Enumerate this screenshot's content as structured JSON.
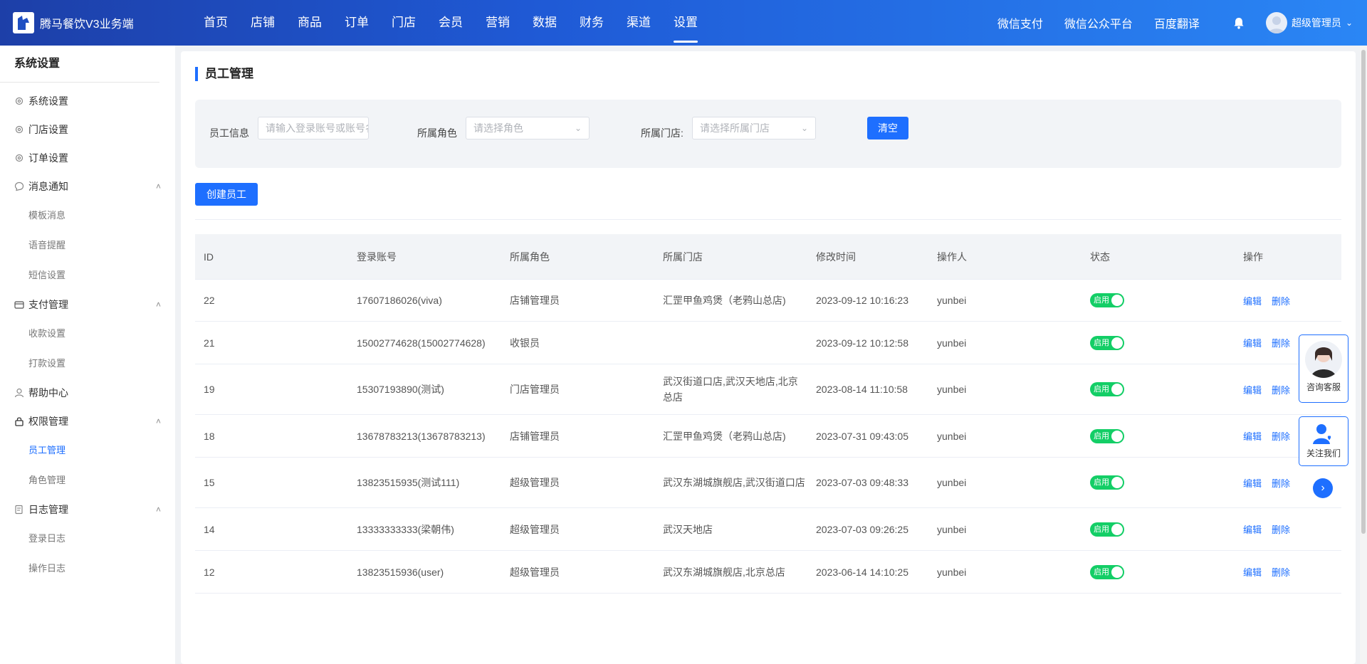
{
  "app": {
    "title": "腾马餐饮V3业务端"
  },
  "topnav": {
    "items": [
      "首页",
      "店铺",
      "商品",
      "订单",
      "门店",
      "会员",
      "营销",
      "数据",
      "财务",
      "渠道",
      "设置"
    ],
    "active_index": 10,
    "right_links": [
      "微信支付",
      "微信公众平台",
      "百度翻译"
    ],
    "user_name": "超级管理员"
  },
  "sidebar": {
    "title": "系统设置",
    "groups": [
      {
        "label": "系统设置",
        "icon": "gear-icon"
      },
      {
        "label": "门店设置",
        "icon": "gear-icon"
      },
      {
        "label": "订单设置",
        "icon": "gear-icon"
      },
      {
        "label": "消息通知",
        "icon": "message-icon",
        "children": [
          "模板消息",
          "语音提醒",
          "短信设置"
        ]
      },
      {
        "label": "支付管理",
        "icon": "payment-icon",
        "children": [
          "收款设置",
          "打款设置"
        ]
      },
      {
        "label": "帮助中心",
        "icon": "user-icon"
      },
      {
        "label": "权限管理",
        "icon": "lock-icon",
        "children": [
          "员工管理",
          "角色管理"
        ],
        "active_child": "员工管理"
      },
      {
        "label": "日志管理",
        "icon": "log-icon",
        "children": [
          "登录日志",
          "操作日志"
        ]
      }
    ]
  },
  "page": {
    "title": "员工管理",
    "filter": {
      "info_label": "员工信息",
      "info_placeholder": "请输入登录账号或账号名称",
      "role_label": "所属角色",
      "role_placeholder": "请选择角色",
      "store_label": "所属门店:",
      "store_placeholder": "请选择所属门店",
      "clear_label": "清空"
    },
    "create_label": "创建员工"
  },
  "table": {
    "headers": [
      "ID",
      "登录账号",
      "所属角色",
      "所属门店",
      "修改时间",
      "操作人",
      "状态",
      "操作"
    ],
    "status_label": "启用",
    "edit_label": "编辑",
    "delete_label": "删除",
    "rows": [
      {
        "id": "22",
        "account": "17607186026(viva)",
        "role": "店铺管理员",
        "store": "汇罡甲鱼鸡煲（老鸦山总店)",
        "time": "2023-09-12 10:16:23",
        "operator": "yunbei"
      },
      {
        "id": "21",
        "account": "15002774628(15002774628)",
        "role": "收银员",
        "store": "",
        "time": "2023-09-12 10:12:58",
        "operator": "yunbei"
      },
      {
        "id": "19",
        "account": "15307193890(测试)",
        "role": "门店管理员",
        "store": "武汉街道口店,武汉天地店,北京总店",
        "time": "2023-08-14 11:10:58",
        "operator": "yunbei"
      },
      {
        "id": "18",
        "account": "13678783213(13678783213)",
        "role": "店铺管理员",
        "store": "汇罡甲鱼鸡煲（老鸦山总店)",
        "time": "2023-07-31 09:43:05",
        "operator": "yunbei"
      },
      {
        "id": "15",
        "account": "13823515935(测试111)",
        "role": "超级管理员",
        "store": "武汉东湖城旗舰店,武汉街道口店",
        "time": "2023-07-03 09:48:33",
        "operator": "yunbei"
      },
      {
        "id": "14",
        "account": "13333333333(梁朝伟)",
        "role": "超级管理员",
        "store": "武汉天地店",
        "time": "2023-07-03 09:26:25",
        "operator": "yunbei"
      },
      {
        "id": "12",
        "account": "13823515936(user)",
        "role": "超级管理员",
        "store": "武汉东湖城旗舰店,北京总店",
        "time": "2023-06-14 14:10:25",
        "operator": "yunbei"
      }
    ]
  },
  "float": {
    "consult_label": "咨询客服",
    "follow_label": "关注我们"
  },
  "colors": {
    "primary": "#1e6fff",
    "toggle_on": "#13ce66",
    "topbar_start": "#1d3fa8",
    "topbar_end": "#2a86f5"
  }
}
